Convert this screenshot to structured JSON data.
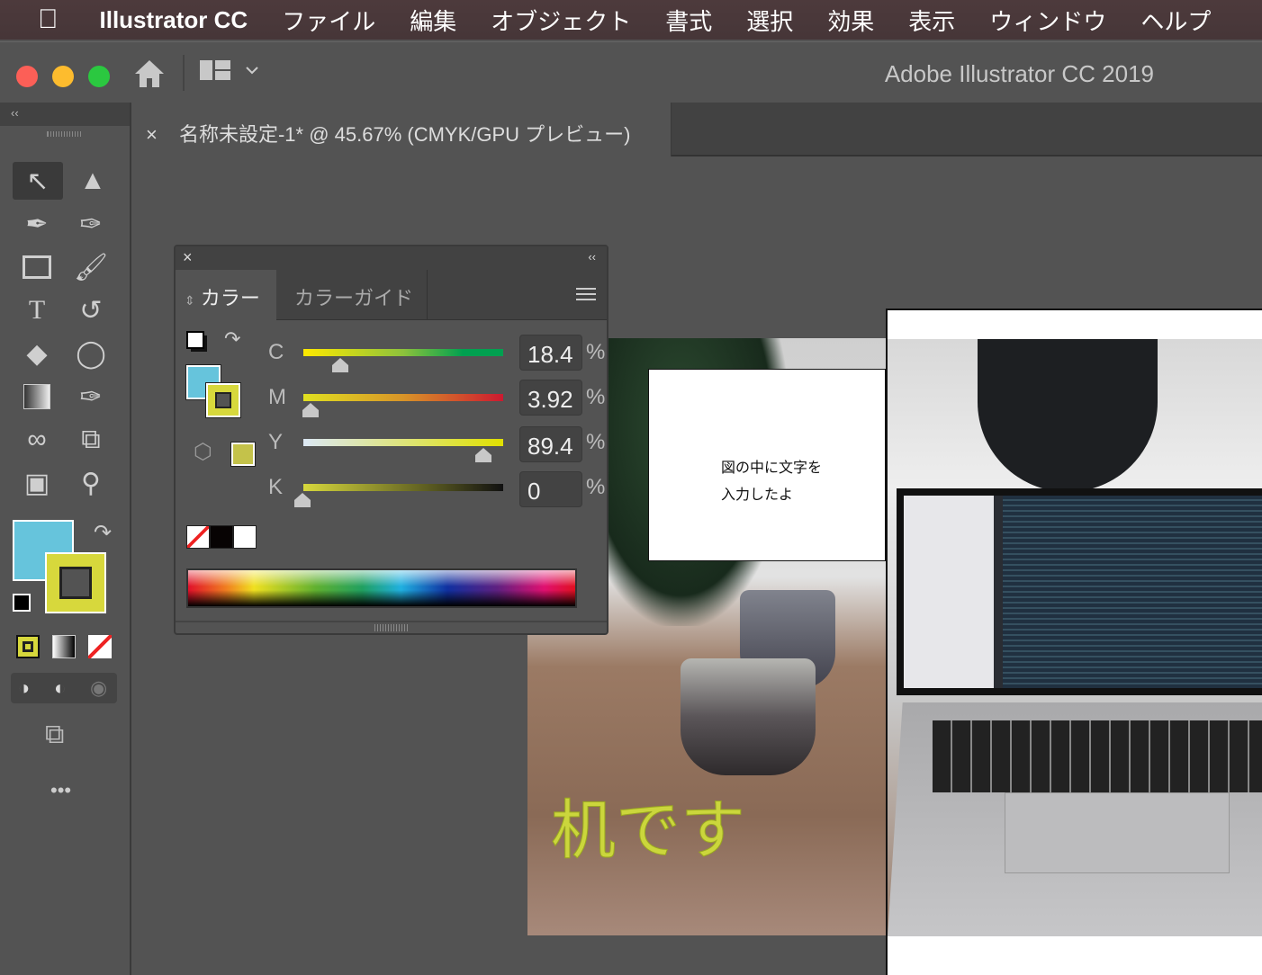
{
  "menubar": {
    "apple": "",
    "app": "Illustrator CC",
    "items": [
      "ファイル",
      "編集",
      "オブジェクト",
      "書式",
      "選択",
      "効果",
      "表示",
      "ウィンドウ",
      "ヘルプ"
    ]
  },
  "window": {
    "title": "Adobe Illustrator CC 2019"
  },
  "toolbar": {
    "collapse": "‹‹",
    "more": "•••"
  },
  "document_tab": {
    "close": "×",
    "title": "名称未設定-1* @ 45.67% (CMYK/GPU プレビュー)"
  },
  "color_panel": {
    "close": "×",
    "collapse": "‹‹",
    "tabs": [
      "カラー",
      "カラーガイド"
    ],
    "sliders": [
      {
        "label": "C",
        "value": "18.4",
        "fraction": 0.184
      },
      {
        "label": "M",
        "value": "3.92",
        "fraction": 0.0392
      },
      {
        "label": "Y",
        "value": "89.4",
        "fraction": 0.894
      },
      {
        "label": "K",
        "value": "0",
        "fraction": 0
      }
    ],
    "unit": "%",
    "fill_color": "#66c4dc",
    "stroke_color": "#d7d83c",
    "out_of_gamut_color": "#c4c24a"
  },
  "canvas": {
    "textbox": [
      "図の中に文字を",
      "入力したよ"
    ],
    "outline_text": "机です"
  }
}
